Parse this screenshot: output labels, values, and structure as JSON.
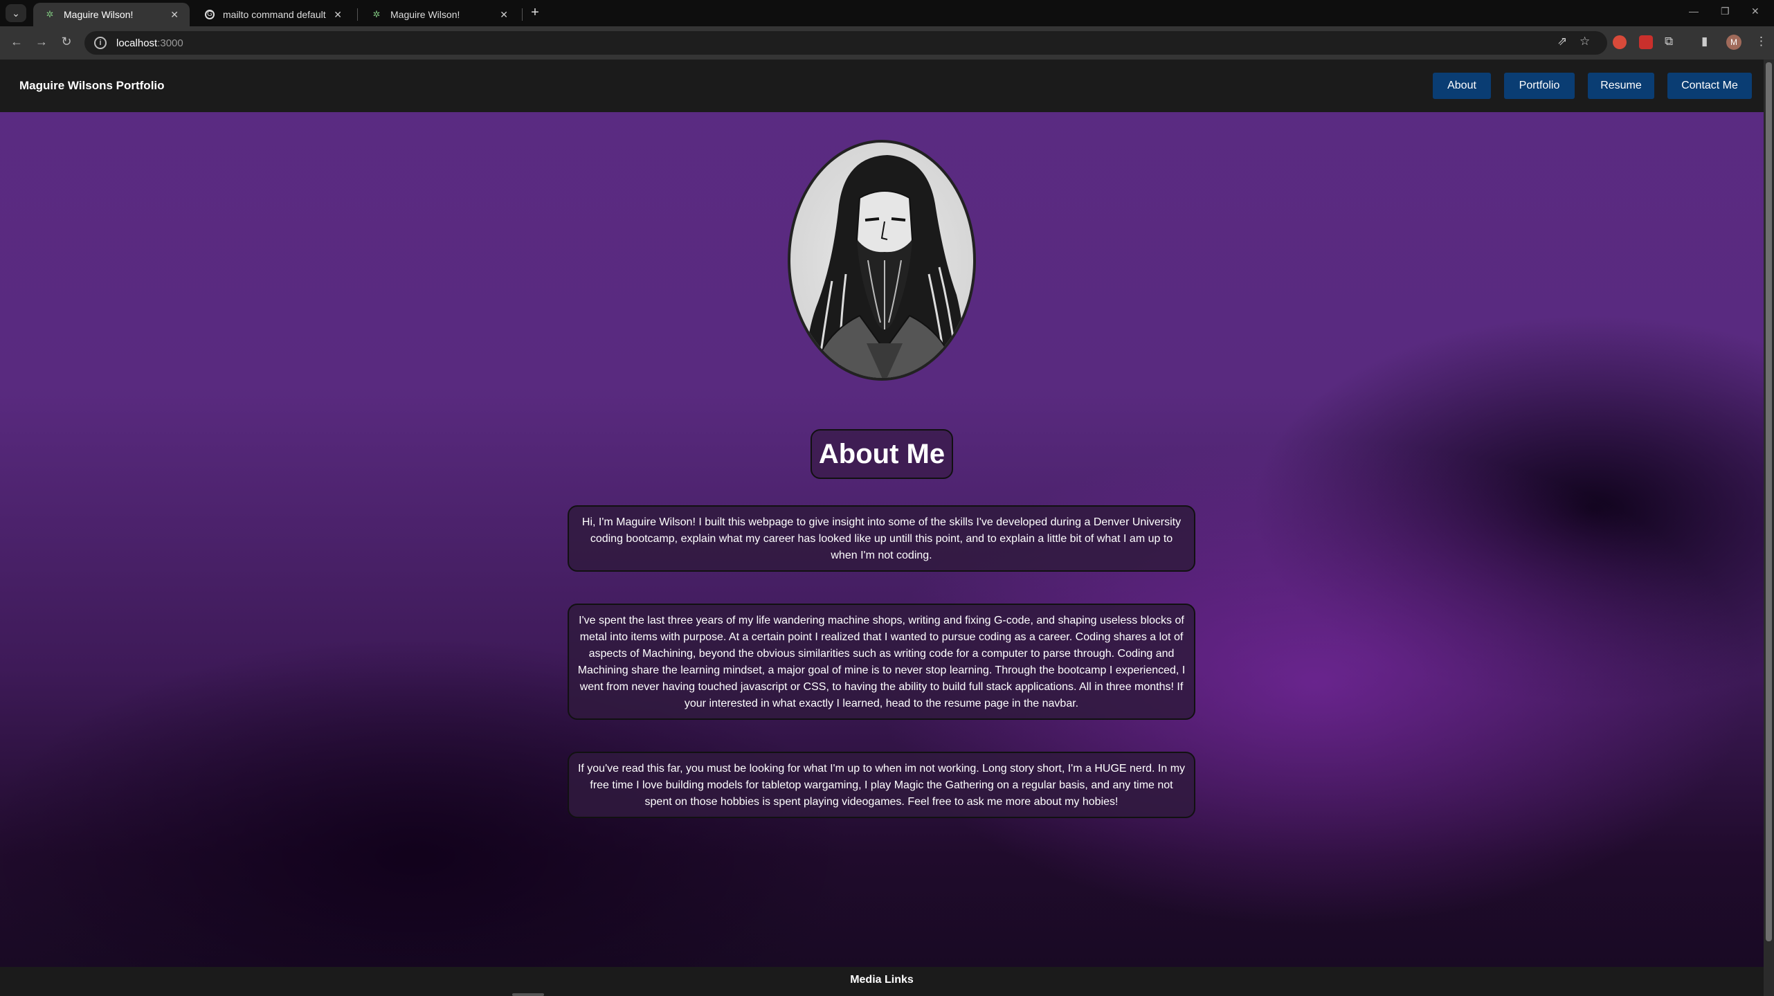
{
  "browser": {
    "tabs": [
      {
        "title": "Maguire Wilson!",
        "active": true,
        "favicon": "tree-favicon"
      },
      {
        "title": "mailto command default app -",
        "active": false,
        "favicon": "google-favicon"
      },
      {
        "title": "Maguire Wilson!",
        "active": false,
        "favicon": "tree-favicon"
      }
    ],
    "url_host": "localhost",
    "url_port": ":3000",
    "avatar_letter": "M"
  },
  "site": {
    "brand": "Maguire Wilsons Portfolio",
    "nav": [
      {
        "label": "About"
      },
      {
        "label": "Portfolio"
      },
      {
        "label": "Resume"
      },
      {
        "label": "Contact Me"
      }
    ],
    "nav_button_color": "#0a3d73"
  },
  "about": {
    "title": "About Me",
    "paragraphs": [
      "Hi, I'm Maguire Wilson! I built this webpage to give insight into some of the skills I've developed during a Denver University coding bootcamp, explain what my career has looked like up untill this point, and to explain a little bit of what I am up to when I'm not coding.",
      "I've spent the last three years of my life wandering machine shops, writing and fixing G-code, and shaping useless blocks of metal into items with purpose. At a certain point I realized that I wanted to pursue coding as a career. Coding shares a lot of aspects of Machining, beyond the obvious similarities such as writing code for a computer to parse through. Coding and Machining share the learning mindset, a major goal of mine is to never stop learning. Through the bootcamp I experienced, I went from never having touched javascript or CSS, to having the ability to build full stack applications. All in three months! If your interested in what exactly I learned, head to the resume page in the navbar.",
      "If you've read this far, you must be looking for what I'm up to when im not working. Long story short, I'm a HUGE nerd. In my free time I love building models for tabletop wargaming, I play Magic the Gathering on a regular basis, and any time not spent on those hobbies is spent playing videogames. Feel free to ask me more about my hobies!"
    ]
  },
  "footer": {
    "title": "Media Links"
  },
  "colors": {
    "background_top": "#5a2b82",
    "background_bottom": "#170a22",
    "navbar": "#1b1b1b"
  }
}
